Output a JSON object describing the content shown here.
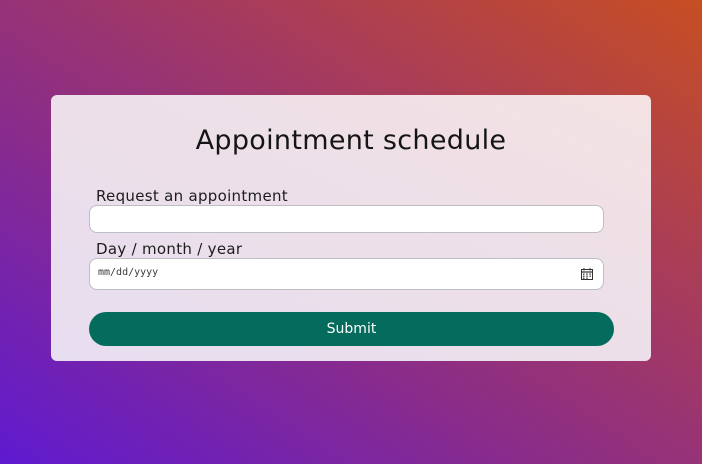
{
  "form": {
    "title": "Appointment schedule",
    "request_label": "Request an appointment",
    "request_value": "",
    "date_label": "Day / month / year",
    "date_placeholder": "mm/dd/yyyy",
    "date_icon": "calendar-icon",
    "submit_label": "Submit"
  },
  "colors": {
    "background_gradient": [
      "#5f1ad0",
      "#a83c5a",
      "#c74e22"
    ],
    "card": "#ece0ec",
    "submit_button": "#056b5d",
    "submit_text": "#ffffff"
  }
}
